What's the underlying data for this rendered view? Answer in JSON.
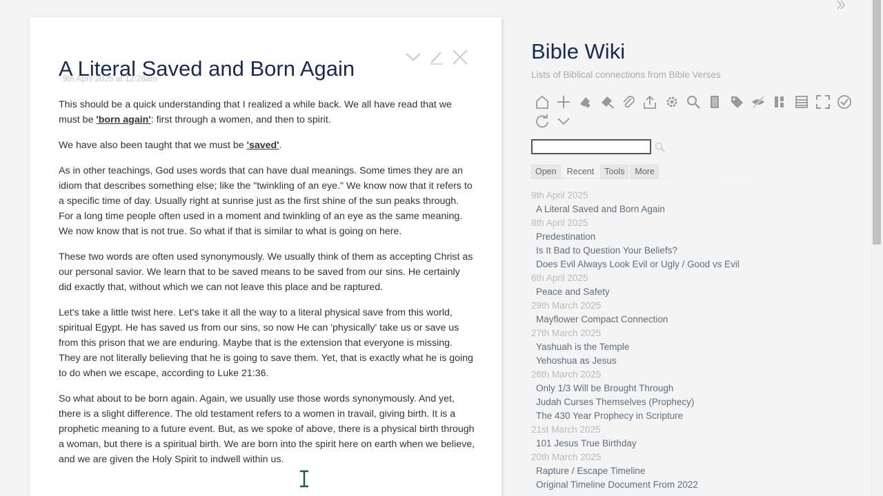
{
  "tiddler": {
    "title": "A Literal Saved and Born Again",
    "date": "9th April 2025 at 12:26am",
    "controls": [
      "chevron-down-icon",
      "edit-icon",
      "close-icon"
    ],
    "paragraphs": {
      "p1a": "This should be a quick understanding that I realized a while back. We all have read that we must be ",
      "p1_link": "'born again'",
      "p1b": ": first through a women, and then to spirit.",
      "p2a": "We have also been taught that we must be ",
      "p2_link": "'saved'",
      "p2b": ".",
      "p3": "As in other teachings, God uses words that can have dual meanings. Some times they are an idiom that describes something else; like the \"twinkling of an eye.\" We know now that it refers to a specific time of day. Usually right at sunrise just as the first shine of the sun peaks through. For a long time people often used in a moment and twinkling of an eye as the same meaning. We now know that is not true. So what if that is similar to what is going on here.",
      "p4": "These two words are often used synonymously. We usually think of them as accepting Christ as our personal savior. We learn that to be saved means to be saved from our sins. He certainly did exactly that, without which we can not leave this place and be raptured.",
      "p5": "Let's take a little twist here. Let's take it all the way to a literal physical save from this world, spiritual Egypt. He has saved us from our sins, so now He can 'physically' take us or save us from this prison that we are enduring. Maybe that is the extension that everyone is missing. They are not literally believing that he is going to save them. Yet, that is exactly what he is going to do when we escape, according to Luke 21:36.",
      "p6": "So what about to be born again. Again, we usually use those words synonymously. And yet, there is a slight difference. The old testament refers to a women in travail, giving birth. It is a prophetic meaning to a future event. But, as we spoke of above, there is a physical birth through a woman, but there is a spiritual birth. We are born into the spirit here on earth when we believe, and we are given the Holy Spirit to indwell within us."
    }
  },
  "sidebar": {
    "title": "Bible Wiki",
    "subtitle": "Lists of Biblical connections from Bible Verses",
    "toolbar_row1": [
      "home-icon",
      "new-tiddler-icon",
      "new-journal-icon",
      "new-image-icon",
      "import-icon",
      "export-icon",
      "control-panel-icon",
      "advanced-search-icon",
      "manager-icon",
      "tag-manager-icon",
      "hide-icon",
      "layout-icon",
      "storyview-icon",
      "fullscreen-icon",
      "save-icon"
    ],
    "toolbar_row2": [
      "refresh-icon",
      "more-chevron-icon"
    ],
    "search": {
      "value": "",
      "placeholder": ""
    },
    "tabs": [
      "Open",
      "Recent",
      "Tools",
      "More"
    ],
    "active_tab": "Recent",
    "recent": [
      {
        "date": "9th April 2025",
        "items": [
          "A Literal Saved and Born Again"
        ]
      },
      {
        "date": "8th April 2025",
        "items": [
          "Predestination",
          "Is It Bad to Question Your Beliefs?",
          "Does Evil Always Look Evil or Ugly / Good vs Evil"
        ]
      },
      {
        "date": "6th April 2025",
        "items": [
          "Peace and Safety"
        ]
      },
      {
        "date": "29th March 2025",
        "items": [
          "Mayflower Compact Connection"
        ]
      },
      {
        "date": "27th March 2025",
        "items": [
          "Yashuah is the Temple",
          "Yehoshua as Jesus"
        ]
      },
      {
        "date": "26th March 2025",
        "items": [
          "Only 1/3 Will be Brought Through",
          "Judah Curses Themselves (Prophecy)",
          "The 430 Year Prophecy in Scripture"
        ]
      },
      {
        "date": "21st March 2025",
        "items": [
          "101 Jesus True Birthday"
        ]
      },
      {
        "date": "20th March 2025",
        "items": [
          "Rapture / Escape Timeline",
          "Original Timeline Document From 2022"
        ]
      }
    ]
  },
  "colors": {
    "title": "#182955",
    "link": "#5e6e7e",
    "date": "#bbbbbb",
    "icon": "#9a9a9a"
  }
}
